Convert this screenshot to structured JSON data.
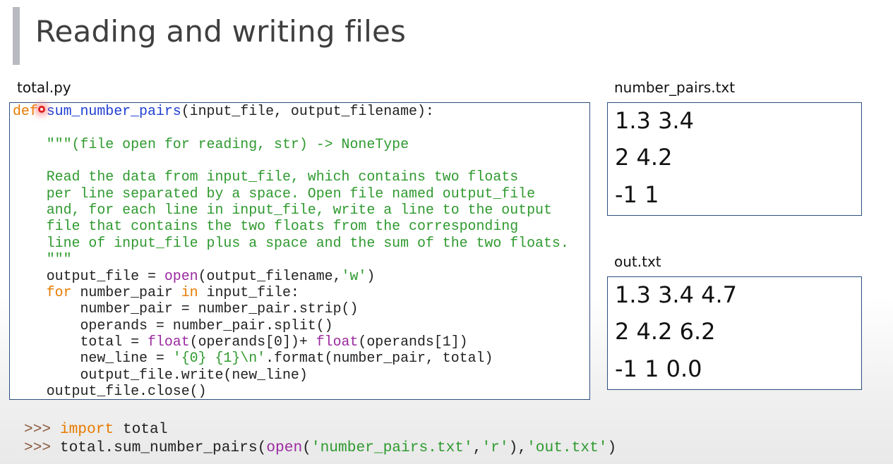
{
  "slide": {
    "title": "Reading and writing files",
    "accent_color": "#b9b9c2"
  },
  "code_panel": {
    "filename": "total.py",
    "lines": [
      [
        {
          "t": "def",
          "c": "kw"
        },
        {
          "t": " ",
          "c": ""
        },
        {
          "t": "sum_number_pairs",
          "c": "fn"
        },
        {
          "t": "(input_file, output_filename):",
          "c": ""
        }
      ],
      [],
      [
        {
          "t": "    \"\"\"(file open for reading, str) -> NoneType",
          "c": "doc"
        }
      ],
      [],
      [
        {
          "t": "    Read the data from input_file, which contains two floats",
          "c": "doc"
        }
      ],
      [
        {
          "t": "    per line separated by a space. Open file named output_file",
          "c": "doc"
        }
      ],
      [
        {
          "t": "    and, for each line in input_file, write a line to the output",
          "c": "doc"
        }
      ],
      [
        {
          "t": "    file that contains the two floats from the corresponding",
          "c": "doc"
        }
      ],
      [
        {
          "t": "    line of input_file plus a space and the sum of the two floats.",
          "c": "doc"
        }
      ],
      [
        {
          "t": "    \"\"\"",
          "c": "doc"
        }
      ],
      [
        {
          "t": "    output_file = ",
          "c": ""
        },
        {
          "t": "open",
          "c": "bi"
        },
        {
          "t": "(output_filename,",
          "c": ""
        },
        {
          "t": "'w'",
          "c": "str"
        },
        {
          "t": ")",
          "c": ""
        }
      ],
      [
        {
          "t": "    ",
          "c": ""
        },
        {
          "t": "for",
          "c": "kw"
        },
        {
          "t": " number_pair ",
          "c": ""
        },
        {
          "t": "in",
          "c": "kw"
        },
        {
          "t": " input_file:",
          "c": ""
        }
      ],
      [
        {
          "t": "        number_pair = number_pair.strip()",
          "c": ""
        }
      ],
      [
        {
          "t": "        operands = number_pair.split()",
          "c": ""
        }
      ],
      [
        {
          "t": "        total = ",
          "c": ""
        },
        {
          "t": "float",
          "c": "bi"
        },
        {
          "t": "(operands[0])+ ",
          "c": ""
        },
        {
          "t": "float",
          "c": "bi"
        },
        {
          "t": "(operands[1])",
          "c": ""
        }
      ],
      [
        {
          "t": "        new_line = ",
          "c": ""
        },
        {
          "t": "'{0} {1}\\n'",
          "c": "str"
        },
        {
          "t": ".format(number_pair, total)",
          "c": ""
        }
      ],
      [
        {
          "t": "        output_file.write(new_line)",
          "c": ""
        }
      ],
      [
        {
          "t": "    output_file.close()",
          "c": ""
        }
      ]
    ]
  },
  "number_pairs_panel": {
    "filename": "number_pairs.txt",
    "lines": [
      "1.3 3.4",
      "2 4.2",
      "-1 1"
    ]
  },
  "out_panel": {
    "filename": "out.txt",
    "lines": [
      "1.3 3.4 4.7",
      "2 4.2 6.2",
      "-1 1 0.0"
    ]
  },
  "repl": {
    "lines": [
      [
        {
          "t": ">>> ",
          "c": "prompt"
        },
        {
          "t": "import",
          "c": "kw"
        },
        {
          "t": " total",
          "c": ""
        }
      ],
      [
        {
          "t": ">>> ",
          "c": "prompt"
        },
        {
          "t": "total.sum_number_pairs(",
          "c": ""
        },
        {
          "t": "open",
          "c": "bi"
        },
        {
          "t": "(",
          "c": ""
        },
        {
          "t": "'number_pairs.txt'",
          "c": "str"
        },
        {
          "t": ",",
          "c": ""
        },
        {
          "t": "'r'",
          "c": "str"
        },
        {
          "t": "),",
          "c": ""
        },
        {
          "t": "'out.txt'",
          "c": "str"
        },
        {
          "t": ")",
          "c": ""
        }
      ]
    ]
  },
  "colors": {
    "keyword": "#e87b00",
    "function_name": "#1f3fd1",
    "docstring": "#2f9a2f",
    "builtin": "#9b2aa0",
    "panel_border": "#2c4f80"
  }
}
